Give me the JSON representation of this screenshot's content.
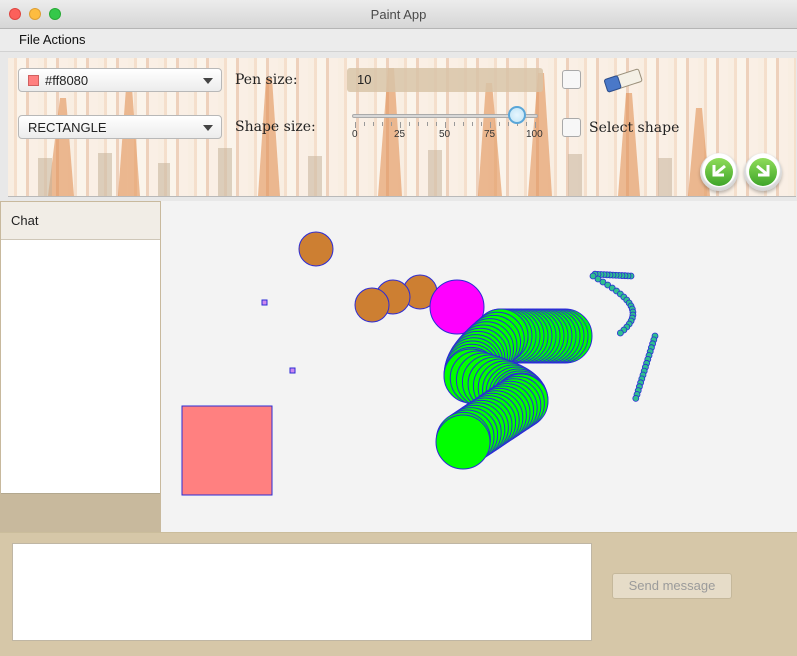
{
  "window": {
    "title": "Paint App"
  },
  "menu": {
    "items": [
      "File Actions"
    ]
  },
  "toolbar": {
    "color_value": "#ff8080",
    "shape_value": "RECTANGLE",
    "pen_size_label": "Pen size:",
    "pen_size_value": "10",
    "shape_size_label": "Shape size:",
    "shape_size_slider": {
      "value": 90,
      "min": 0,
      "max": 100,
      "tick_labels": [
        "0",
        "25",
        "50",
        "75",
        "100"
      ]
    },
    "eraser_icon": "eraser-icon",
    "select_shape_label": "Select shape",
    "undo_icon": "undo-icon",
    "redo_icon": "redo-icon"
  },
  "chat": {
    "title": "Chat",
    "messages": []
  },
  "composer": {
    "input_value": "",
    "send_label": "Send message"
  },
  "colors": {
    "accent": "#5aa6d8",
    "selected_color": "#ff8080",
    "shape_stroke": "#2b2bd6",
    "circle_fill": "#cd7f32",
    "magenta": "#ff00ff",
    "green": "#00ff00"
  }
}
